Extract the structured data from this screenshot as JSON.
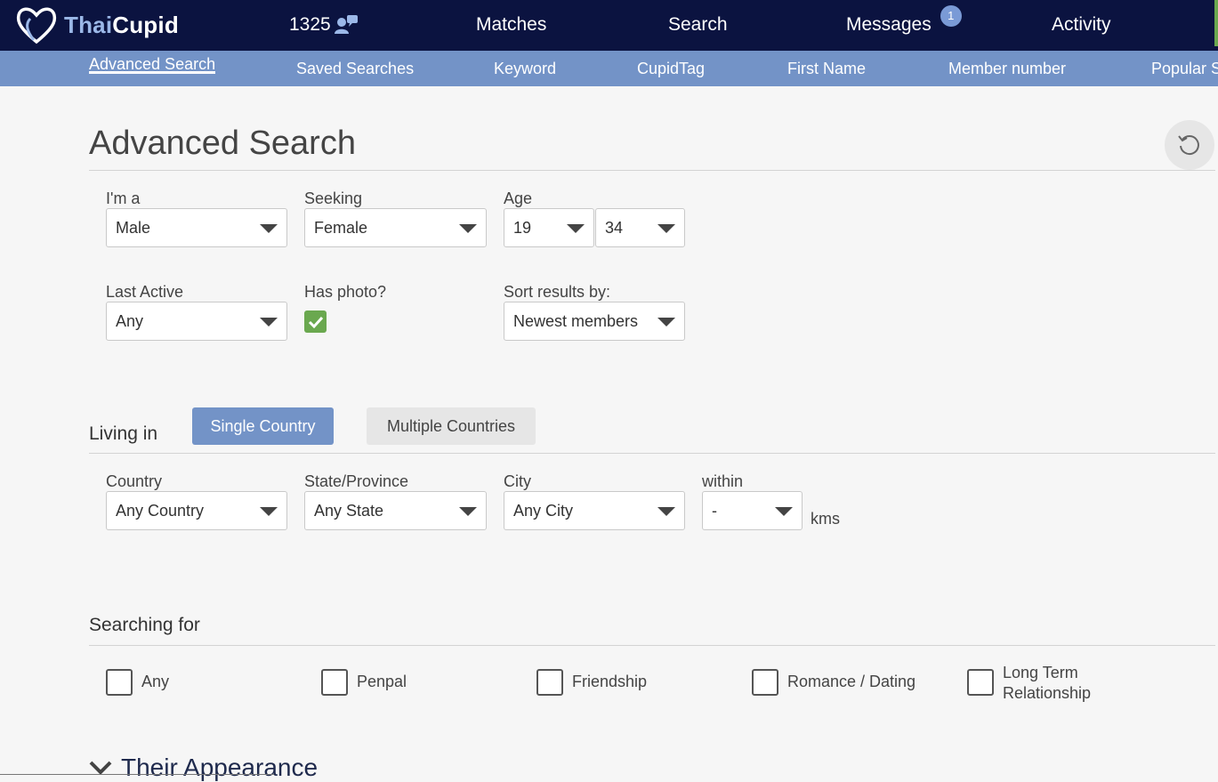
{
  "brand": {
    "thai": "Thai",
    "cupid": "Cupid"
  },
  "topnav": {
    "count": "1325",
    "matches": "Matches",
    "search": "Search",
    "messages": "Messages",
    "messages_badge": "1",
    "activity": "Activity"
  },
  "subnav": [
    "Advanced Search",
    "Saved Searches",
    "Keyword",
    "CupidTag",
    "First Name",
    "Member number",
    "Popular S"
  ],
  "page": {
    "title": "Advanced Search"
  },
  "form": {
    "im_a": {
      "label": "I'm a",
      "value": "Male"
    },
    "seeking": {
      "label": "Seeking",
      "value": "Female"
    },
    "age": {
      "label": "Age",
      "min": "19",
      "max": "34"
    },
    "last_active": {
      "label": "Last Active",
      "value": "Any"
    },
    "has_photo": {
      "label": "Has photo?",
      "checked": true
    },
    "sort": {
      "label": "Sort results by:",
      "value": "Newest members"
    }
  },
  "living": {
    "label": "Living in",
    "single": "Single Country",
    "multiple": "Multiple Countries",
    "country": {
      "label": "Country",
      "value": "Any Country"
    },
    "state": {
      "label": "State/Province",
      "value": "Any State"
    },
    "city": {
      "label": "City",
      "value": "Any City"
    },
    "within": {
      "label": "within",
      "value": "-"
    },
    "unit": "kms"
  },
  "searching_for": {
    "label": "Searching for",
    "options": [
      "Any",
      "Penpal",
      "Friendship",
      "Romance / Dating",
      "Long Term",
      "Relationship"
    ]
  },
  "appearance": {
    "title": "Their Appearance"
  },
  "colors": {
    "nav": "#0b1340",
    "subnav": "#7393c7",
    "accent": "#6aa84f"
  }
}
